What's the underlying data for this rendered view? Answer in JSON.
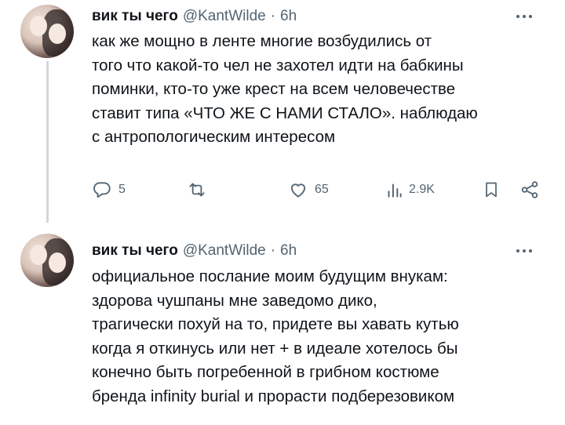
{
  "tweets": [
    {
      "author_name": "вик ты чего",
      "handle": "@KantWilde",
      "separator": "·",
      "time": "6h",
      "text": "как же мощно в ленте многие возбудились от\nтого что какой-то чел не захотел идти на бабкины\nпоминки, кто-то уже крест на всем человечестве\nставит типа «ЧТО ЖЕ С НАМИ СТАЛО». наблюдаю\nс антропологическим интересом",
      "replies": "5",
      "retweets": "",
      "likes": "65",
      "views": "2.9K"
    },
    {
      "author_name": "вик ты чего",
      "handle": "@KantWilde",
      "separator": "·",
      "time": "6h",
      "text": "официальное послание моим будущим внукам:\nздорова чушпаны мне заведомо дико,\nтрагически похуй на то, придете вы хавать кутью\nкогда я откинусь или нет + в идеале хотелось бы\nконечно быть погребенной в грибном костюме\nбренда infinity burial и прорасти подберезовиком"
    }
  ],
  "icons": [
    "reply-icon",
    "retweet-icon",
    "like-icon",
    "views-icon",
    "bookmark-icon",
    "share-icon",
    "more-icon"
  ],
  "colors": {
    "text": "#0f1419",
    "secondary": "#536471",
    "thread_line": "#cfd9de",
    "background": "#ffffff"
  }
}
